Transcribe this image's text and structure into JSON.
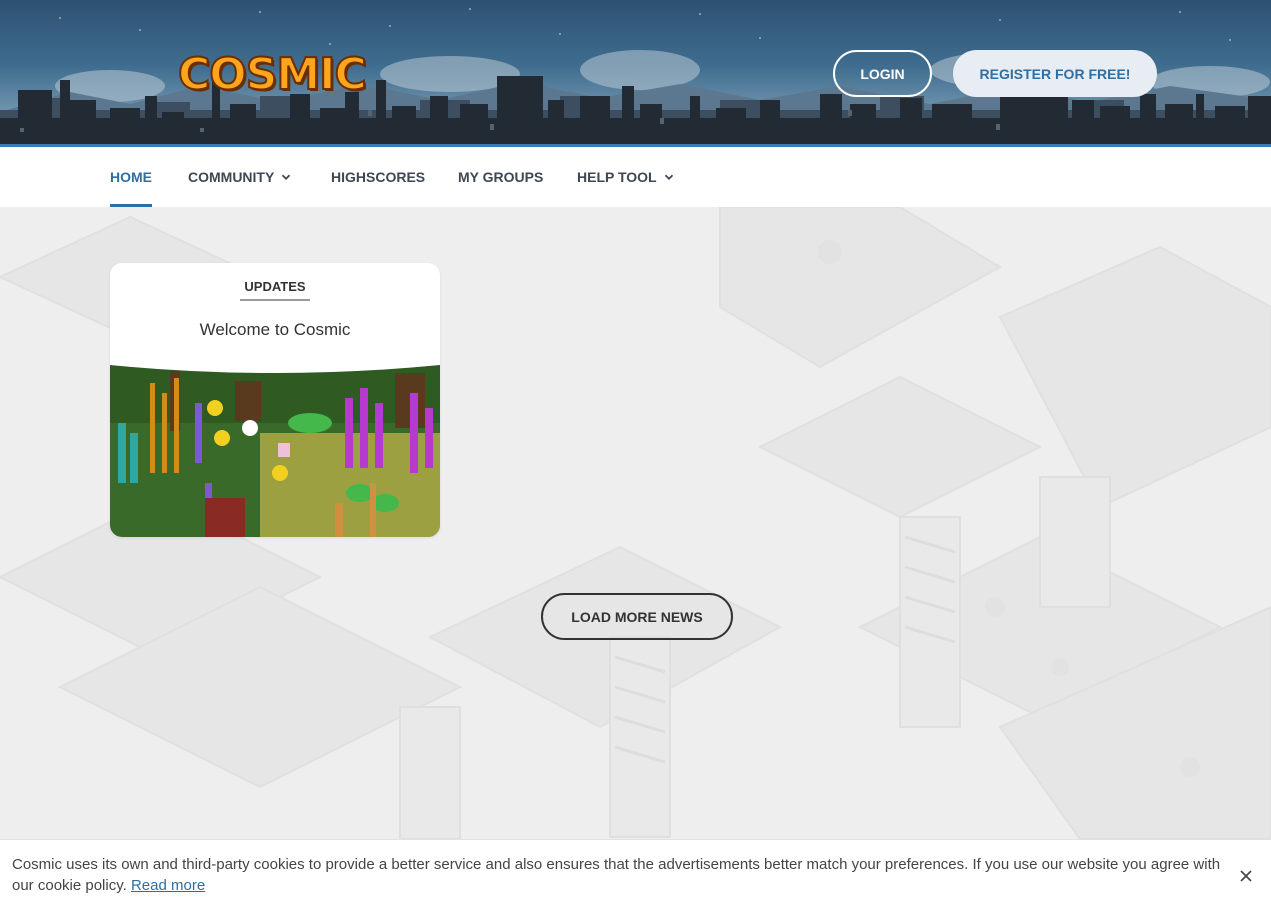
{
  "header": {
    "logo_text": "COSMIC",
    "login_label": "LOGIN",
    "register_label": "REGISTER FOR FREE!"
  },
  "nav": {
    "items": [
      {
        "label": "HOME",
        "active": true
      },
      {
        "label": "COMMUNITY",
        "has_dropdown": true,
        "icon": "chevron-down-icon"
      },
      {
        "label": "HIGHSCORES"
      },
      {
        "label": "MY GROUPS"
      },
      {
        "label": "HELP TOOL",
        "has_dropdown": true,
        "icon": "chevron-down-icon"
      }
    ]
  },
  "news": {
    "cards": [
      {
        "category": "UPDATES",
        "title": "Welcome to Cosmic"
      }
    ],
    "load_more_label": "LOAD MORE NEWS"
  },
  "cookie_bar": {
    "text": "Cosmic uses its own and third-party cookies to provide a better service and also ensures that the advertisements better match your preferences. If you use our website you agree with our cookie policy.",
    "link_label": "Read more",
    "close_icon": "close-icon"
  },
  "colors": {
    "accent": "#2e6ea3",
    "logo": "#ffa51c",
    "page_bg": "#eeeeee"
  }
}
